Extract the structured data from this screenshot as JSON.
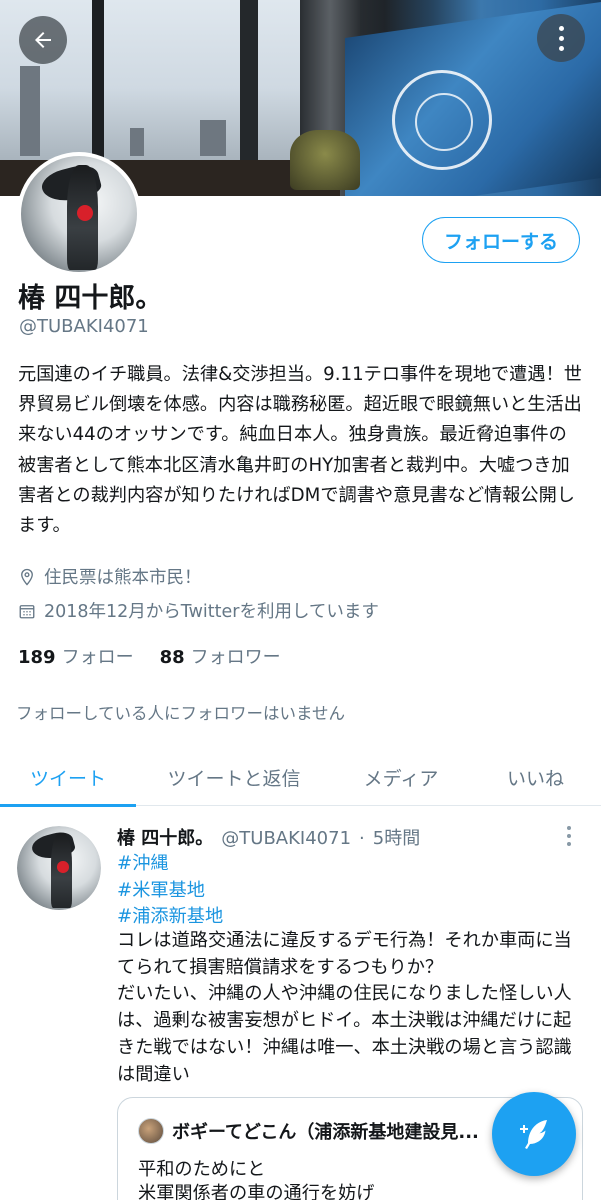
{
  "profile": {
    "display_name": "椿 四十郎。",
    "handle": "@TUBAKI4071",
    "follow_button": "フォローする",
    "bio": "元国連のイチ職員。法律&交渉担当。9.11テロ事件を現地で遭遇！世界貿易ビル倒壊を体感。内容は職務秘匿。超近眼で眼鏡無いと生活出来ない44のオッサンです。純血日本人。独身貴族。最近脅迫事件の被害者として熊本北区清水亀井町のHY加害者と裁判中。大嘘つき加害者との裁判内容が知りたければDMで調書や意見書など情報公開します。",
    "location": "住民票は熊本市民！",
    "joined": "2018年12月からTwitterを利用しています",
    "following_count": "189",
    "following_label": "フォロー",
    "followers_count": "88",
    "followers_label": "フォロワー",
    "followed_by": "フォローしている人にフォロワーはいません"
  },
  "tabs": [
    {
      "label": "ツイート",
      "active": true
    },
    {
      "label": "ツイートと返信",
      "active": false
    },
    {
      "label": "メディア",
      "active": false
    },
    {
      "label": "いいね",
      "active": false
    }
  ],
  "tweet": {
    "name": "椿 四十郎。",
    "handle": "@TUBAKI4071",
    "separator": "·",
    "time": "5時間",
    "hashtags": [
      "#沖縄",
      "#米軍基地",
      "#浦添新基地"
    ],
    "text": "コレは道路交通法に違反するデモ行為！それか車両に当てられて損害賠償請求をするつもりか？\nだいたい、沖縄の人や沖縄の住民になりました怪しい人は、過剰な被害妄想がヒドイ。本土決戦は沖縄だけに起きた戦ではない！沖縄は唯一、本土決戦の場と言う認識は間違い",
    "quote": {
      "name": "ボギーてどこん（浦添新基地建設見...",
      "text_line1": "平和のためにと",
      "text_line2": "米軍関係者の車の通行を妨げ"
    }
  },
  "icons": {
    "back": "arrow-left-icon",
    "more": "more-vertical-icon",
    "location": "location-pin-icon",
    "calendar": "calendar-icon",
    "compose": "compose-feather-icon"
  },
  "colors": {
    "accent": "#1da1f2",
    "secondary_text": "#657786",
    "primary_text": "#14171a"
  }
}
